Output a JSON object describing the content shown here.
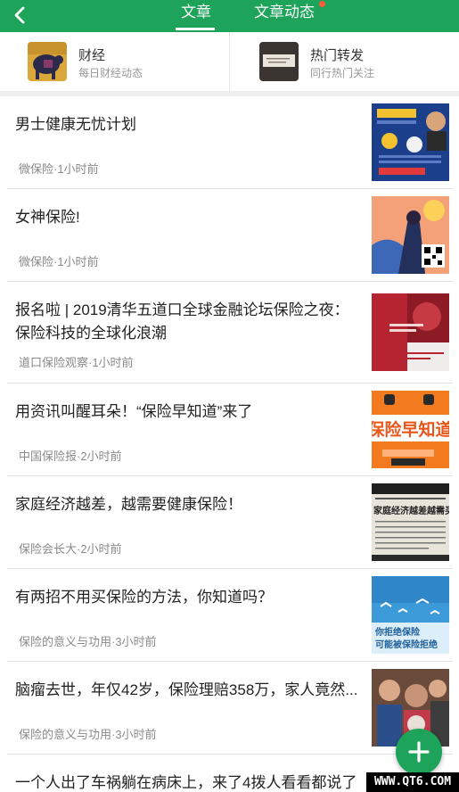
{
  "header": {
    "tabs": [
      {
        "label": "文章",
        "active": true
      },
      {
        "label": "文章动态",
        "has_dot": true
      }
    ]
  },
  "quick": [
    {
      "title": "财经",
      "subtitle": "每日财经动态"
    },
    {
      "title": "热门转发",
      "subtitle": "同行热门关注"
    }
  ],
  "articles": [
    {
      "title": "男士健康无忧计划",
      "meta": "微保险·1小时前"
    },
    {
      "title": "女神保险!",
      "meta": "微保险·1小时前"
    },
    {
      "title": "报名啦 | 2019清华五道口全球金融论坛保险之夜：保险科技的全球化浪潮",
      "meta": "道口保险观察·1小时前"
    },
    {
      "title": "用资讯叫醒耳朵！“保险早知道”来了",
      "meta": "中国保险报·2小时前"
    },
    {
      "title": "家庭经济越差，越需要健康保险！",
      "meta": "保险会长大·2小时前"
    },
    {
      "title": "有两招不用买保险的方法，你知道吗？",
      "meta": "保险的意义与功用·3小时前"
    },
    {
      "title": "脑瘤去世，年仅42岁，保险理赔358万，家人竟然...",
      "meta": "保险的意义与功用·3小时前"
    },
    {
      "title": "一个人出了车祸躺在病床上，来了4拨人看看都说了",
      "meta": ""
    }
  ],
  "thumb_text": {
    "a4": "保险早知道",
    "a5": "家庭经济越差越需买保险",
    "a6_line1": "你拒绝保险",
    "a6_line2": "可能被保险拒绝"
  },
  "watermark": "WWW.QT6.COM",
  "colors": {
    "brand": "#1ea35a",
    "dot": "#ff5a3c"
  }
}
